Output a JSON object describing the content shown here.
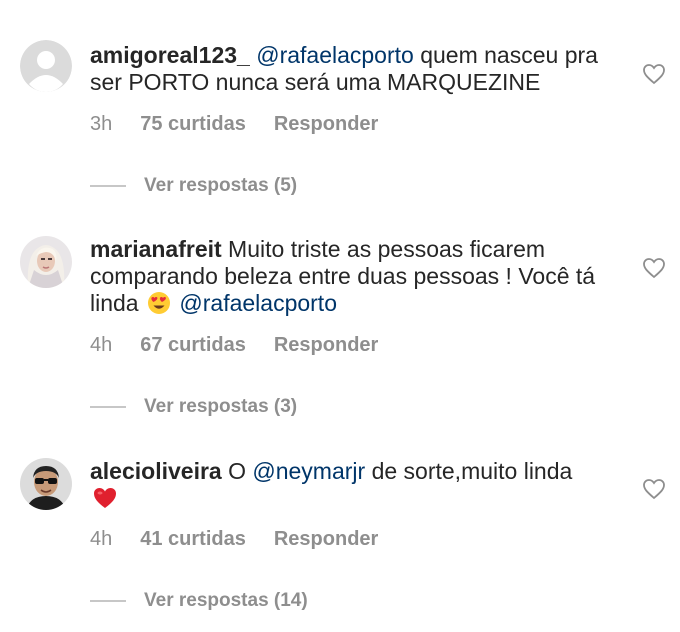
{
  "comments": [
    {
      "username": "amigoreal123_",
      "mention": "@rafaelacporto",
      "text": " quem nasceu pra ser PORTO nunca será uma MARQUEZINE",
      "time": "3h",
      "likes": "75 curtidas",
      "reply": "Responder",
      "view_replies": "Ver respostas (5)",
      "avatar": "default-avatar-icon"
    },
    {
      "username": "marianafreit",
      "text": " Muito triste as pessoas ficarem comparando beleza entre duas pessoas ! Você tá linda",
      "emoji": "heart-eyes-emoji",
      "mention": "@rafaelacporto",
      "time": "4h",
      "likes": "67 curtidas",
      "reply": "Responder",
      "view_replies": "Ver respostas (3)",
      "avatar": "blonde-woman-photo"
    },
    {
      "username": "alecioliveira",
      "text_before": " O ",
      "mention": "@neymarjr",
      "text_after": " de sorte,muito linda",
      "emoji": "red-heart-emoji",
      "time": "4h",
      "likes": "41 curtidas",
      "reply": "Responder",
      "view_replies": "Ver respostas (14)",
      "avatar": "man-sunglasses-photo"
    }
  ],
  "colors": {
    "text": "#262626",
    "meta": "#8e8e8e",
    "mention": "#003569",
    "line": "#c7c7c7"
  }
}
